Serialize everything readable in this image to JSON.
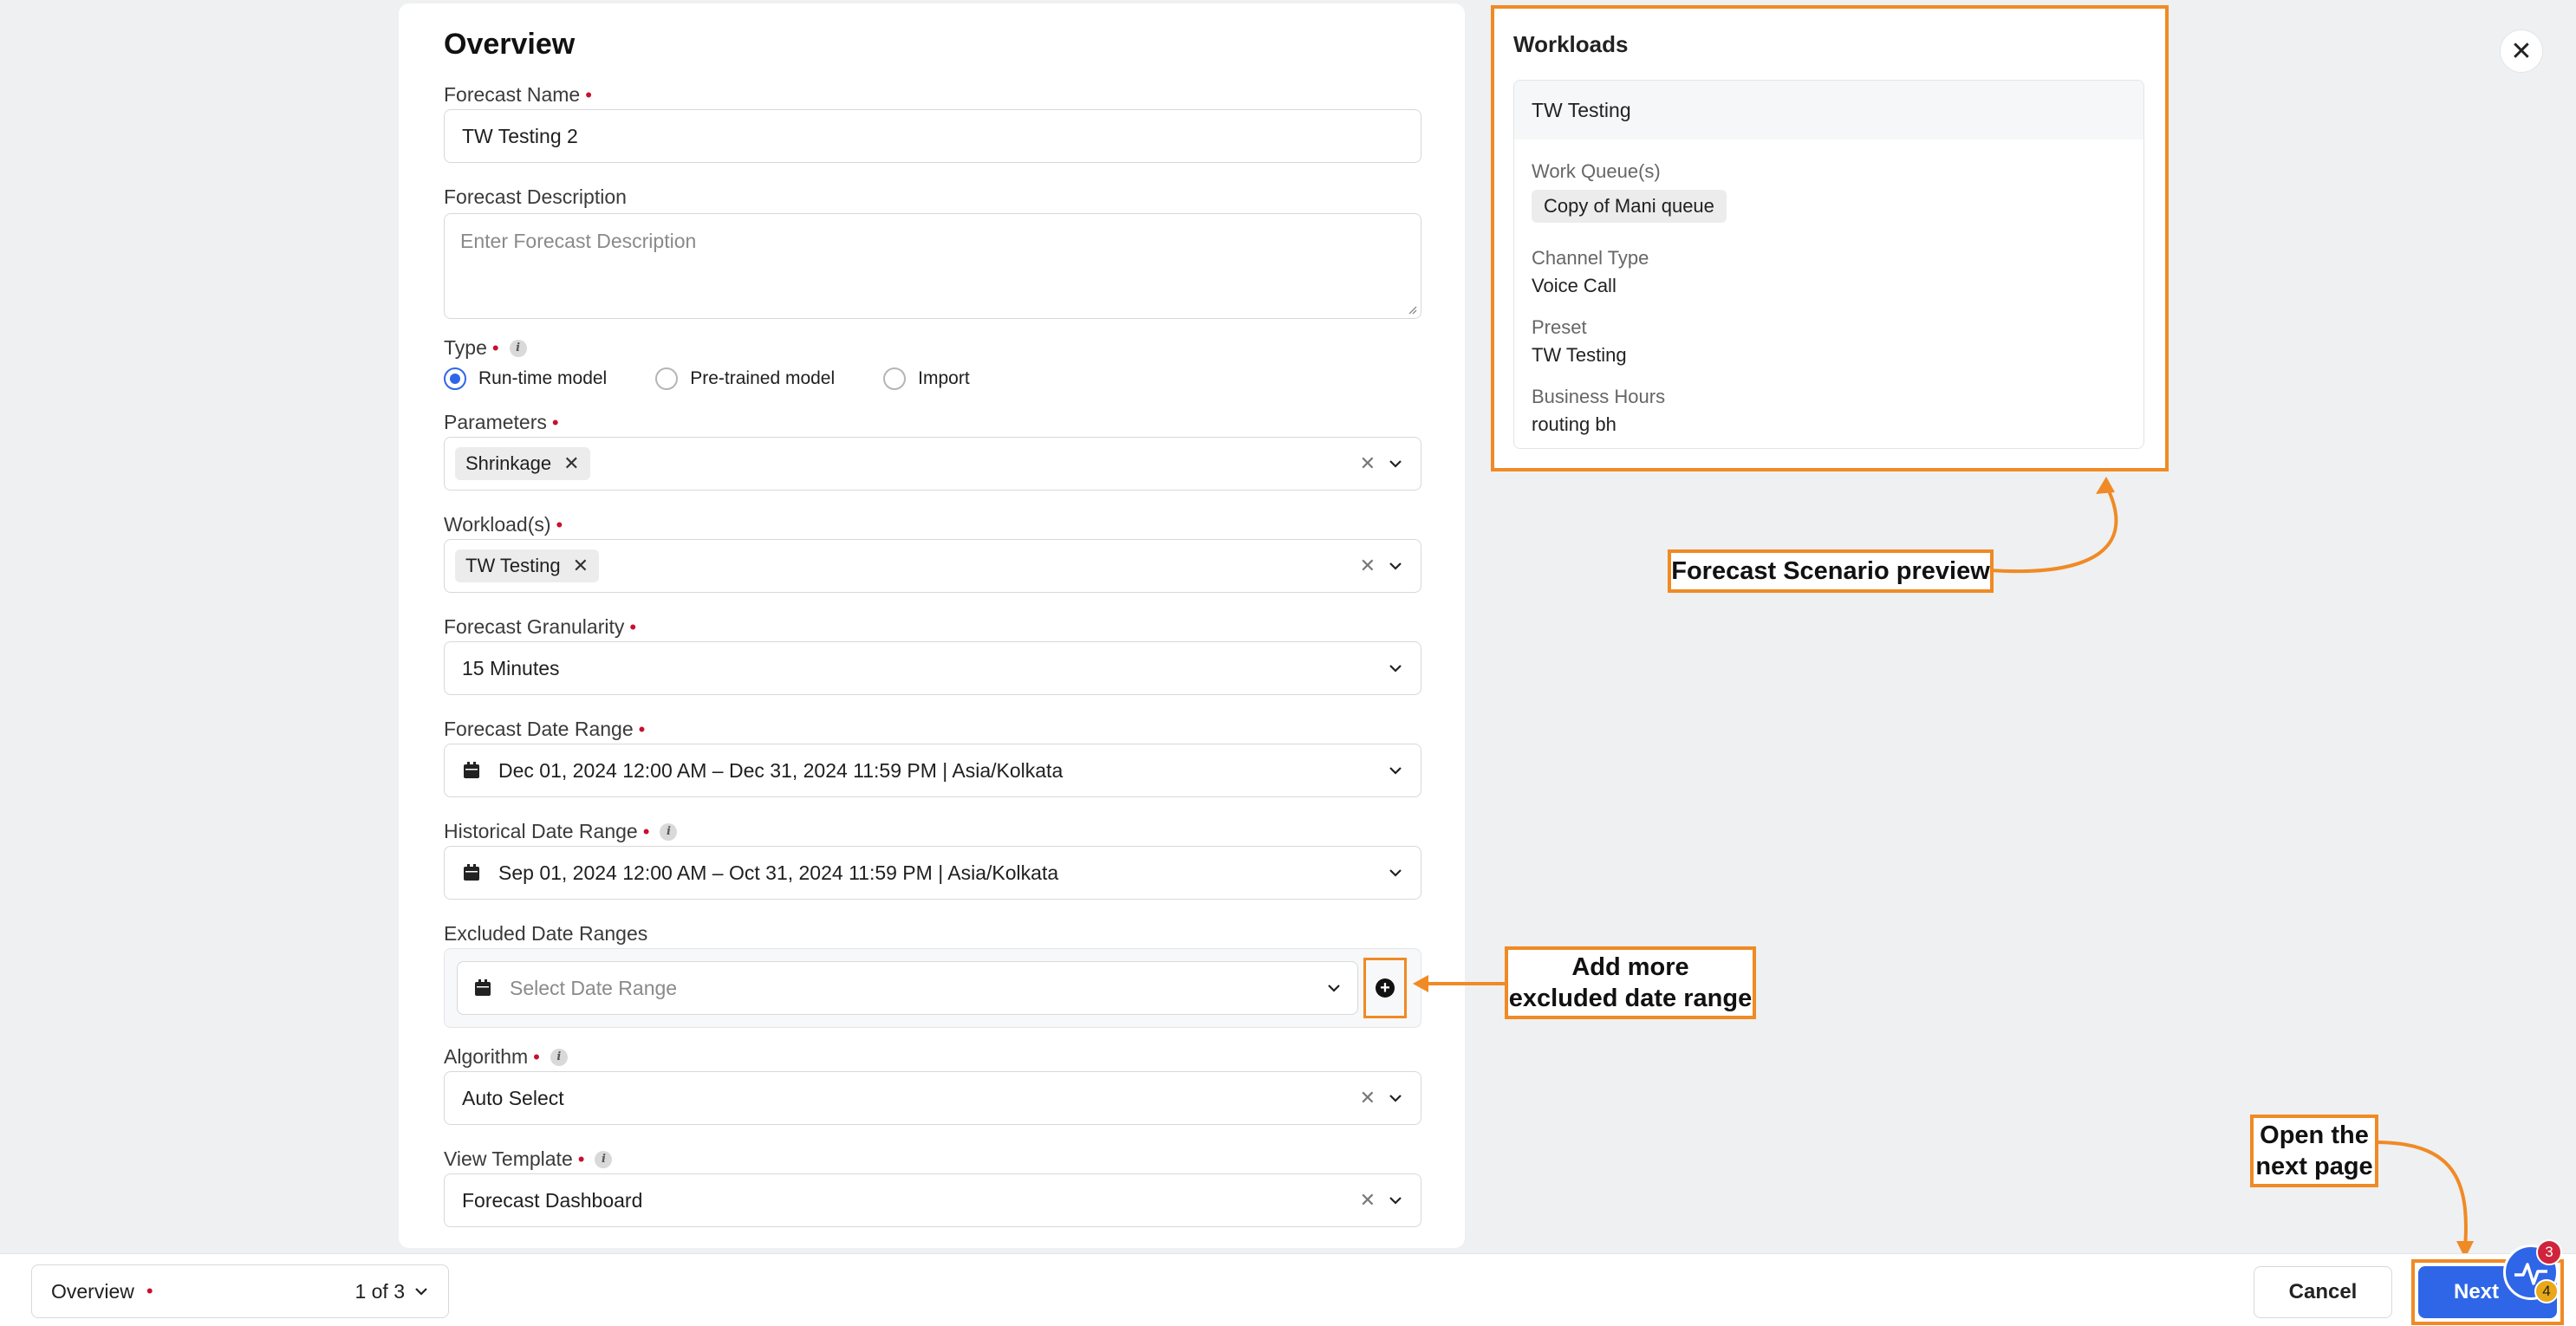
{
  "overview": {
    "title": "Overview",
    "forecast_name": {
      "label": "Forecast Name",
      "value": "TW Testing 2"
    },
    "forecast_description": {
      "label": "Forecast Description",
      "placeholder": "Enter Forecast Description"
    },
    "type": {
      "label": "Type",
      "options": [
        "Run-time model",
        "Pre-trained model",
        "Import"
      ],
      "selected": "Run-time model"
    },
    "parameters": {
      "label": "Parameters",
      "chips": [
        "Shrinkage"
      ]
    },
    "workloads": {
      "label": "Workload(s)",
      "chips": [
        "TW Testing"
      ]
    },
    "granularity": {
      "label": "Forecast Granularity",
      "value": "15 Minutes"
    },
    "forecast_date_range": {
      "label": "Forecast Date Range",
      "value": "Dec 01, 2024 12:00 AM – Dec 31, 2024 11:59 PM | Asia/Kolkata"
    },
    "historical_date_range": {
      "label": "Historical Date Range",
      "value": "Sep 01, 2024 12:00 AM – Oct 31, 2024 11:59 PM | Asia/Kolkata"
    },
    "excluded_date_ranges": {
      "label": "Excluded Date Ranges",
      "placeholder": "Select Date Range"
    },
    "algorithm": {
      "label": "Algorithm",
      "value": "Auto Select"
    },
    "view_template": {
      "label": "View Template",
      "value": "Forecast Dashboard"
    }
  },
  "preview": {
    "title": "Workloads",
    "card_title": "TW Testing",
    "work_queues_label": "Work Queue(s)",
    "work_queue_chip": "Copy of Mani queue",
    "channel_type_label": "Channel Type",
    "channel_type_value": "Voice Call",
    "preset_label": "Preset",
    "preset_value": "TW Testing",
    "business_hours_label": "Business Hours",
    "business_hours_value": "routing bh"
  },
  "annotations": {
    "preview": "Forecast Scenario preview",
    "add_more_line1": "Add more",
    "add_more_line2": "excluded date range",
    "next_line1": "Open the",
    "next_line2": "next page"
  },
  "footer": {
    "step_label": "Overview",
    "step_count": "1 of 3",
    "cancel": "Cancel",
    "next": "Next",
    "badge_red": "3",
    "badge_yellow": "4"
  },
  "colors": {
    "accent": "#2f66e8",
    "callout": "#f08a24",
    "required": "#c8102e"
  },
  "icons": [
    "close-icon",
    "calendar-icon",
    "chevron-down-icon",
    "clear-icon",
    "info-icon",
    "add-circle-icon",
    "help-pulse-icon"
  ]
}
